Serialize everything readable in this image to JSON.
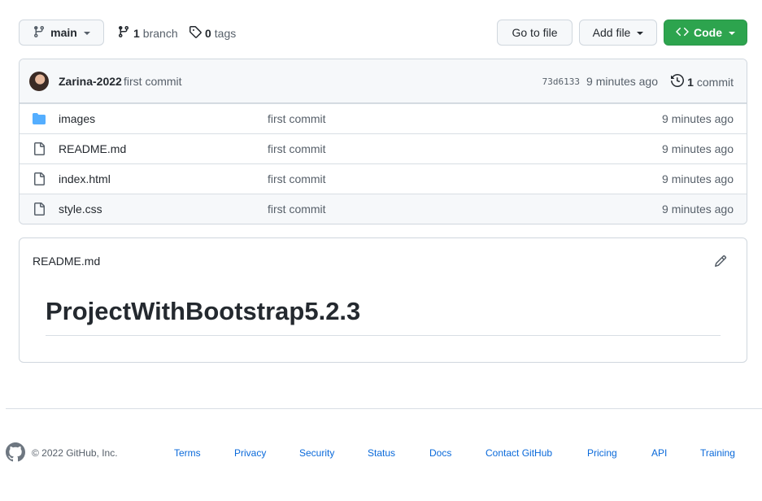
{
  "toolbar": {
    "branch_button_label": "main",
    "branch_count": "1",
    "branch_label": "branch",
    "tag_count": "0",
    "tag_label": "tags",
    "go_to_file_label": "Go to file",
    "add_file_label": "Add file",
    "code_label": "Code"
  },
  "commit": {
    "author": "Zarina-2022",
    "message": "first commit",
    "sha": "73d6133",
    "time": "9 minutes ago",
    "count": "1",
    "count_label": "commit"
  },
  "files": [
    {
      "name": "images",
      "type": "folder",
      "message": "first commit",
      "time": "9 minutes ago"
    },
    {
      "name": "README.md",
      "type": "file",
      "message": "first commit",
      "time": "9 minutes ago"
    },
    {
      "name": "index.html",
      "type": "file",
      "message": "first commit",
      "time": "9 minutes ago"
    },
    {
      "name": "style.css",
      "type": "file",
      "message": "first commit",
      "time": "9 minutes ago"
    }
  ],
  "readme": {
    "title": "README.md",
    "heading": "ProjectWithBootstrap5.2.3"
  },
  "footer": {
    "copyright": "© 2022 GitHub, Inc.",
    "links": [
      "Terms",
      "Privacy",
      "Security",
      "Status",
      "Docs",
      "Contact GitHub",
      "Pricing",
      "API",
      "Training"
    ]
  },
  "colors": {
    "accent_green": "#2da44e",
    "link_blue": "#0969da",
    "folder_blue": "#54aeff"
  }
}
